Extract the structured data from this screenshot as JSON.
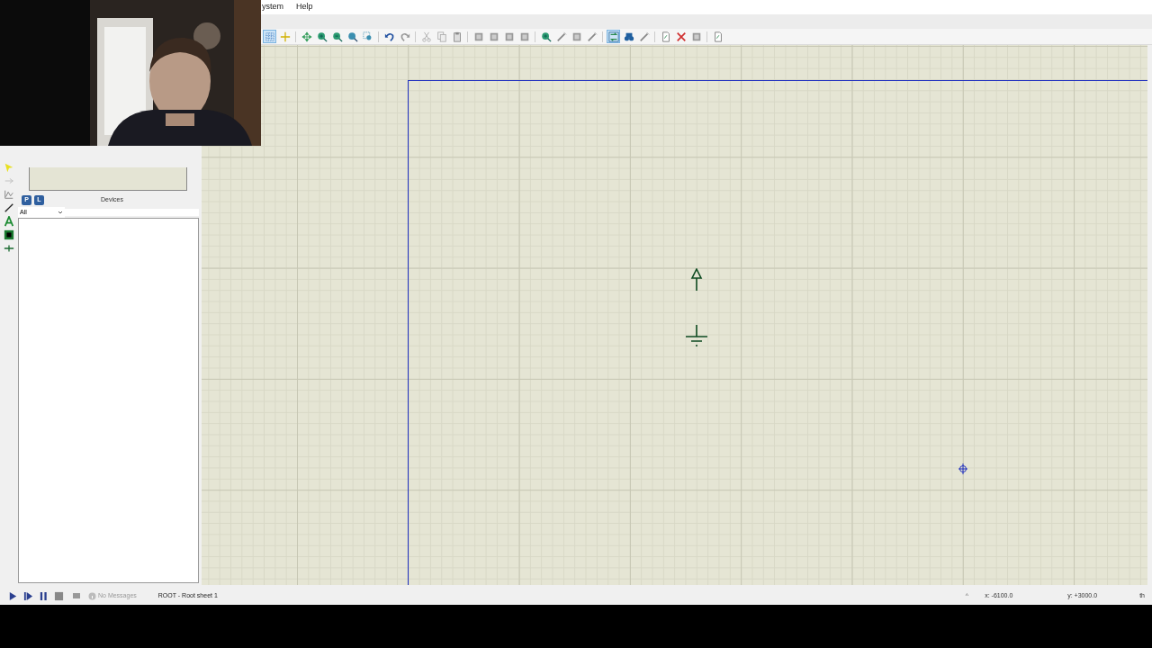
{
  "menu": [
    "ystem",
    "Help"
  ],
  "toolbar": [
    {
      "kind": "grid",
      "selected": true
    },
    {
      "kind": "origin",
      "selected": false
    },
    {
      "kind": "sep"
    },
    {
      "kind": "pan",
      "selected": false
    },
    {
      "kind": "zoomin",
      "selected": false
    },
    {
      "kind": "zoomout",
      "selected": false
    },
    {
      "kind": "zoomall",
      "selected": false
    },
    {
      "kind": "zoomarea",
      "selected": false
    },
    {
      "kind": "sep"
    },
    {
      "kind": "undo",
      "selected": false
    },
    {
      "kind": "redo",
      "selected": false
    },
    {
      "kind": "sep"
    },
    {
      "kind": "cut",
      "selected": false
    },
    {
      "kind": "copy",
      "selected": false
    },
    {
      "kind": "paste",
      "selected": false
    },
    {
      "kind": "sep"
    },
    {
      "kind": "block",
      "selected": false
    },
    {
      "kind": "block",
      "selected": false
    },
    {
      "kind": "block",
      "selected": false
    },
    {
      "kind": "block",
      "selected": false
    },
    {
      "kind": "sep"
    },
    {
      "kind": "zoomin",
      "selected": false
    },
    {
      "kind": "wand",
      "selected": false
    },
    {
      "kind": "block",
      "selected": false
    },
    {
      "kind": "wand",
      "selected": false
    },
    {
      "kind": "sep"
    },
    {
      "kind": "swap",
      "selected": true
    },
    {
      "kind": "binoculars",
      "selected": false
    },
    {
      "kind": "wand",
      "selected": false
    },
    {
      "kind": "sep"
    },
    {
      "kind": "doc",
      "selected": false
    },
    {
      "kind": "delete",
      "selected": false
    },
    {
      "kind": "block",
      "selected": false
    },
    {
      "kind": "sep"
    },
    {
      "kind": "doc",
      "selected": false
    }
  ],
  "side_tools": [
    {
      "kind": "select"
    },
    {
      "kind": "terminal"
    },
    {
      "kind": "graph"
    },
    {
      "kind": "line"
    },
    {
      "kind": "text"
    },
    {
      "kind": "box"
    },
    {
      "kind": "marker"
    }
  ],
  "devices_panel": {
    "pick_buttons": [
      "P",
      "L"
    ],
    "title": "Devices",
    "filter": "All"
  },
  "status_bar": {
    "messages": "No Messages",
    "sheet": "ROOT - Root sheet 1",
    "caret": "^",
    "x": "x: -6100.0",
    "y": "y: +3000.0",
    "units": "th"
  }
}
